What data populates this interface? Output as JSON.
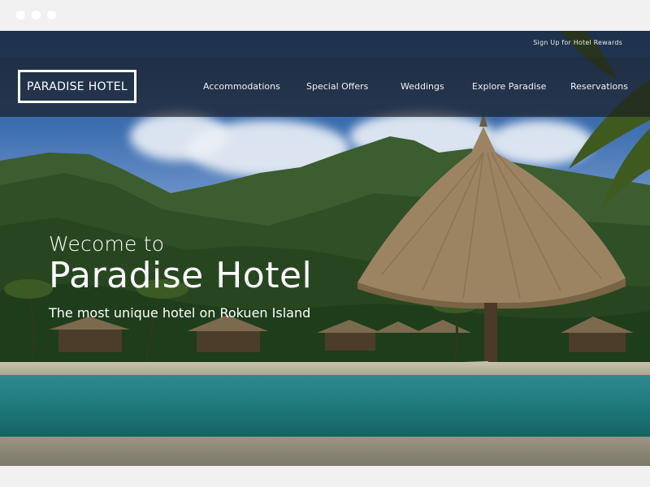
{
  "utility": {
    "rewards_link": "Sign Up for Hotel Rewards"
  },
  "brand": {
    "logo_text": "PARADISE HOTEL"
  },
  "nav": {
    "items": [
      {
        "label": "Accommodations"
      },
      {
        "label": "Special Offers"
      },
      {
        "label": "Weddings"
      },
      {
        "label": "Explore Paradise"
      },
      {
        "label": "Reservations"
      }
    ]
  },
  "hero": {
    "welcome": "Wecome to",
    "title": "Paradise Hotel",
    "tagline": "The most unique hotel on Rokuen Island"
  },
  "colors": {
    "overlay": "#191c22",
    "text": "#ffffff",
    "water": "#1f7b7d",
    "page_bg": "#f1f1f1"
  },
  "background": {
    "scene": "tropical-beach-resort-photo"
  }
}
